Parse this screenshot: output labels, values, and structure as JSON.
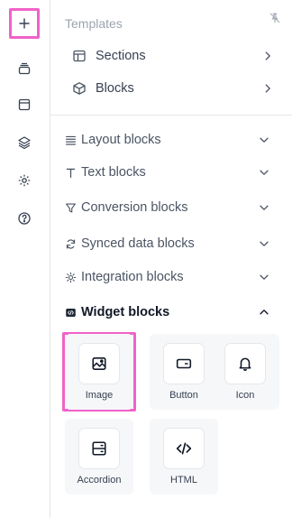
{
  "sidebar": {
    "items": [
      {
        "name": "add-icon"
      },
      {
        "name": "stack-icon"
      },
      {
        "name": "window-icon"
      },
      {
        "name": "layers-icon"
      },
      {
        "name": "gear-icon"
      },
      {
        "name": "help-icon"
      }
    ],
    "active_index": 0,
    "highlight_color": "#f062c8"
  },
  "panel": {
    "header": "Templates",
    "pin_icon": "pin-off-icon",
    "templates": [
      {
        "label": "Sections",
        "icon": "layout-icon"
      },
      {
        "label": "Blocks",
        "icon": "cube-icon"
      }
    ],
    "categories": [
      {
        "label": "Layout blocks",
        "icon": "layout-lines-icon",
        "expanded": false
      },
      {
        "label": "Text blocks",
        "icon": "text-icon",
        "expanded": false
      },
      {
        "label": "Conversion blocks",
        "icon": "filter-icon",
        "expanded": false
      },
      {
        "label": "Synced data blocks",
        "icon": "refresh-icon",
        "expanded": false
      },
      {
        "label": "Integration blocks",
        "icon": "sun-icon",
        "expanded": false
      },
      {
        "label": "Widget blocks",
        "icon": "code-square-icon",
        "expanded": true
      }
    ],
    "widgets": [
      {
        "label": "Image",
        "icon": "image-icon",
        "highlighted": true
      },
      {
        "label": "Button",
        "icon": "button-icon",
        "highlighted": false
      },
      {
        "label": "Icon",
        "icon": "bell-icon",
        "highlighted": false
      },
      {
        "label": "Accordion",
        "icon": "accordion-icon",
        "highlighted": false
      },
      {
        "label": "HTML",
        "icon": "code-icon",
        "highlighted": false
      }
    ]
  }
}
